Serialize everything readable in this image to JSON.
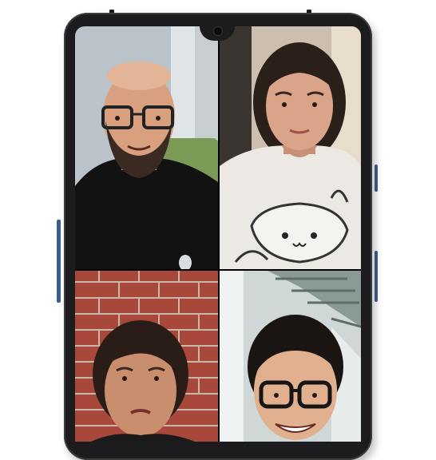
{
  "screen": "group-video-call",
  "colors": {
    "phone_body": "#1c1c1e",
    "side_buttons": "#3b5d93",
    "tile_top_left_bg": "#b5c0c6",
    "tile_top_right_bg": "#d8c9b7",
    "tile_bottom_left_bg": "#a8483a",
    "tile_bottom_right_bg": "#cfd8d6"
  },
  "participants": [
    {
      "tile": "top-left",
      "description_icon": "participant-video"
    },
    {
      "tile": "top-right",
      "description_icon": "participant-video"
    },
    {
      "tile": "bottom-left",
      "description_icon": "participant-video"
    },
    {
      "tile": "bottom-right",
      "description_icon": "participant-video"
    }
  ]
}
